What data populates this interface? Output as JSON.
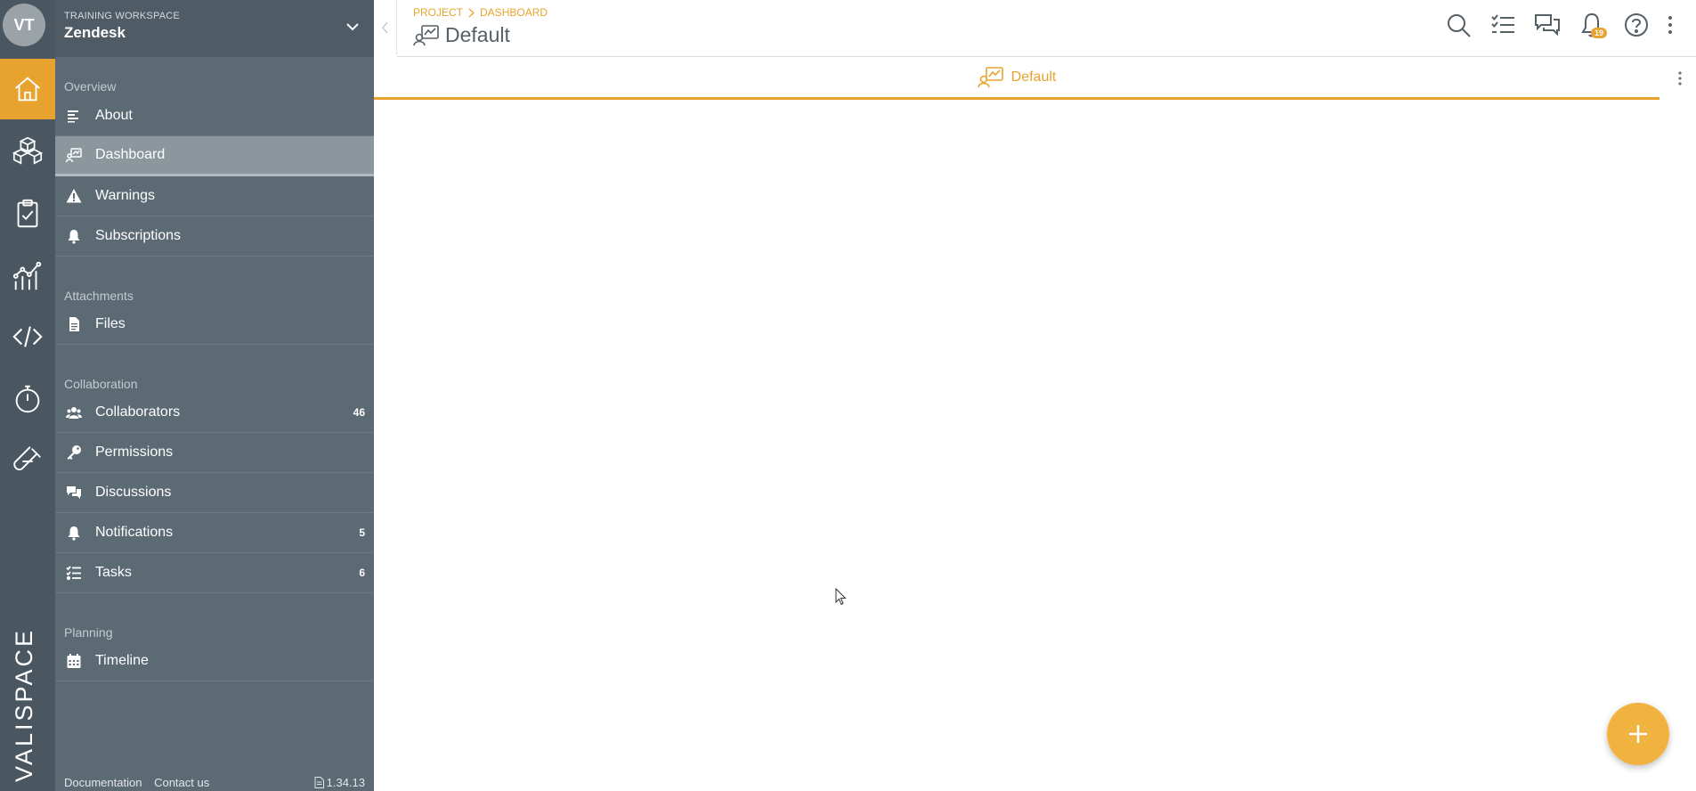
{
  "user": {
    "initials": "VT"
  },
  "workspace": {
    "label": "TRAINING WORKSPACE",
    "name": "Zendesk"
  },
  "rail": {
    "items": [
      {
        "icon": "home-icon",
        "active": true
      },
      {
        "icon": "cubes-icon",
        "active": false
      },
      {
        "icon": "clipboard-check-icon",
        "active": false
      },
      {
        "icon": "analytics-chart-icon",
        "active": false
      },
      {
        "icon": "code-icon",
        "active": false
      },
      {
        "icon": "stopwatch-icon",
        "active": false
      },
      {
        "icon": "test-tube-icon",
        "active": false
      }
    ],
    "logo_text": "VALISPACE"
  },
  "sidebar": {
    "sections": {
      "overview": "Overview",
      "attachments": "Attachments",
      "collaboration": "Collaboration",
      "planning": "Planning"
    },
    "items": {
      "about": {
        "label": "About",
        "icon": "list-icon"
      },
      "dashboard": {
        "label": "Dashboard",
        "icon": "dashboard-icon"
      },
      "warnings": {
        "label": "Warnings",
        "icon": "warning-icon"
      },
      "subscriptions": {
        "label": "Subscriptions",
        "icon": "bell-icon"
      },
      "files": {
        "label": "Files",
        "icon": "file-icon"
      },
      "collaborators": {
        "label": "Collaborators",
        "icon": "users-icon",
        "count": "46"
      },
      "permissions": {
        "label": "Permissions",
        "icon": "key-icon"
      },
      "discussions": {
        "label": "Discussions",
        "icon": "chat-icon"
      },
      "notifications": {
        "label": "Notifications",
        "icon": "bell-icon",
        "count": "5"
      },
      "tasks": {
        "label": "Tasks",
        "icon": "tasks-icon",
        "count": "6"
      },
      "timeline": {
        "label": "Timeline",
        "icon": "calendar-icon"
      }
    },
    "footer": {
      "documentation": "Documentation",
      "contact": "Contact us",
      "version": "1.34.13"
    }
  },
  "header": {
    "breadcrumb": [
      "PROJECT",
      "DASHBOARD"
    ],
    "title": "Default",
    "notifications_badge": "19"
  },
  "tabs": [
    {
      "label": "Default",
      "active": true
    }
  ],
  "colors": {
    "accent": "#e8a32e",
    "rail": "#4a5761",
    "sidebar": "#5c6a74"
  }
}
